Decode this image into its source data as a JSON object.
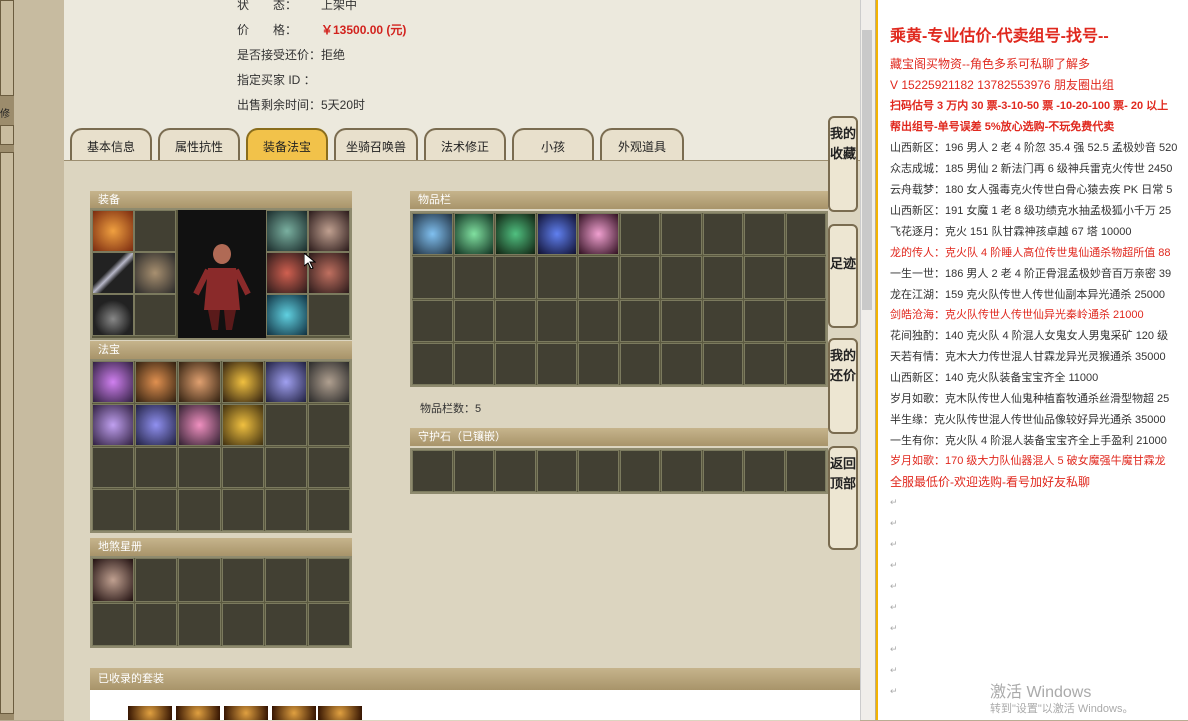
{
  "status_row": {
    "label": "状　　态：",
    "value": "上架中"
  },
  "price_row": {
    "label": "价　　格：",
    "value": "￥13500.00 (元)"
  },
  "bargain_row": {
    "label": "是否接受还价：",
    "value": "拒绝"
  },
  "buyer_row": {
    "label": "指定买家 ID ：",
    "value": ""
  },
  "time_row": {
    "label": "出售剩余时间：",
    "value": "5天20时"
  },
  "tabs": [
    "基本信息",
    "属性抗性",
    "装备法宝",
    "坐骑召唤兽",
    "法术修正",
    "小孩",
    "外观道具"
  ],
  "active_tab": "装备法宝",
  "sections": {
    "equipment": "装备",
    "treasure": "法宝",
    "album": "地煞星册",
    "inventory": "物品栏",
    "guard_stone": "守护石（已镶嵌）",
    "collected_sets": "已收录的套装"
  },
  "inventory_count": "物品栏数：5",
  "side_nav": [
    {
      "text": "我的收藏"
    },
    {
      "text": "足迹"
    },
    {
      "text": "我的还价"
    },
    {
      "text": "返回顶部"
    }
  ],
  "left_strip_label": "修",
  "right_panel": {
    "title": "乘黄-专业估价-代卖组号-找号--",
    "subtitle": "藏宝阁买物资--角色多系可私聊了解多",
    "phone": "V 15225921182   13782553976 朋友圈出组",
    "line_estimate": "扫码估号 3 万内 30 票-3-10-50 票  -10-20-100 票- 20 以上",
    "line_help": "帮出组号-单号误差 5%放心选购-不玩免费代卖",
    "listings": [
      {
        "text": "山西新区：196 男人 2 老 4 阶忽 35.4 强 52.5 孟极妙音 520",
        "red": false
      },
      {
        "text": "众志成城：185 男仙 2 新法门再 6 级神兵雷克火传世 2450",
        "red": false
      },
      {
        "text": "云舟载梦：180 女人强毒克火传世白骨心猿去疾 PK 日常 5",
        "red": false
      },
      {
        "text": "山西新区：191 女魔 1 老 8 级功绩克水抽孟极狐小千万 25",
        "red": false
      },
      {
        "text": "飞花逐月：克火 151 队甘霖神孩卓越 67 塔 10000",
        "red": false
      },
      {
        "text": "龙的传人：克火队 4 阶睡人高位传世鬼仙通杀物超所值 88",
        "red": true
      },
      {
        "text": "一生一世：186 男人 2 老 4 阶正骨混孟极妙音百万亲密 39",
        "red": false
      },
      {
        "text": "龙在江湖：159 克火队传世人传世仙副本异光通杀 25000",
        "red": false
      },
      {
        "text": "剑皓沧海：克火队传世人传世仙异光秦岭通杀 21000",
        "red": true
      },
      {
        "text": "花间独酌：140 克火队 4 阶混人女鬼女人男鬼采矿 120 级",
        "red": false
      },
      {
        "text": "天若有情：克木大力传世混人甘霖龙异光灵猴通杀 35000",
        "red": false
      },
      {
        "text": "山西新区：140 克火队装备宝宝齐全 11000",
        "red": false
      },
      {
        "text": "岁月如歌：克木队传世人仙鬼种植畜牧通杀丝滑型物超 25",
        "red": false
      },
      {
        "text": "半生缘：克火队传世混人传世仙品像较好异光通杀 35000",
        "red": false
      },
      {
        "text": "一生有你：克火队 4 阶混人装备宝宝齐全上手盈利 21000",
        "red": false
      },
      {
        "text": "岁月如歌：170 级大力队仙器混人 5 破女魔强牛魔甘霖龙",
        "red": true
      },
      {
        "text": "全服最低价-欢迎选购-看号加好友私聊",
        "red": true
      }
    ],
    "return_mark": "↵",
    "watermark_title": "激活 Windows",
    "watermark_sub": "转到\"设置\"以激活 Windows。"
  },
  "colors": {
    "accent_red": "#e0281e",
    "active_tab": "#f2c24a",
    "right_border": "#f4b400"
  }
}
